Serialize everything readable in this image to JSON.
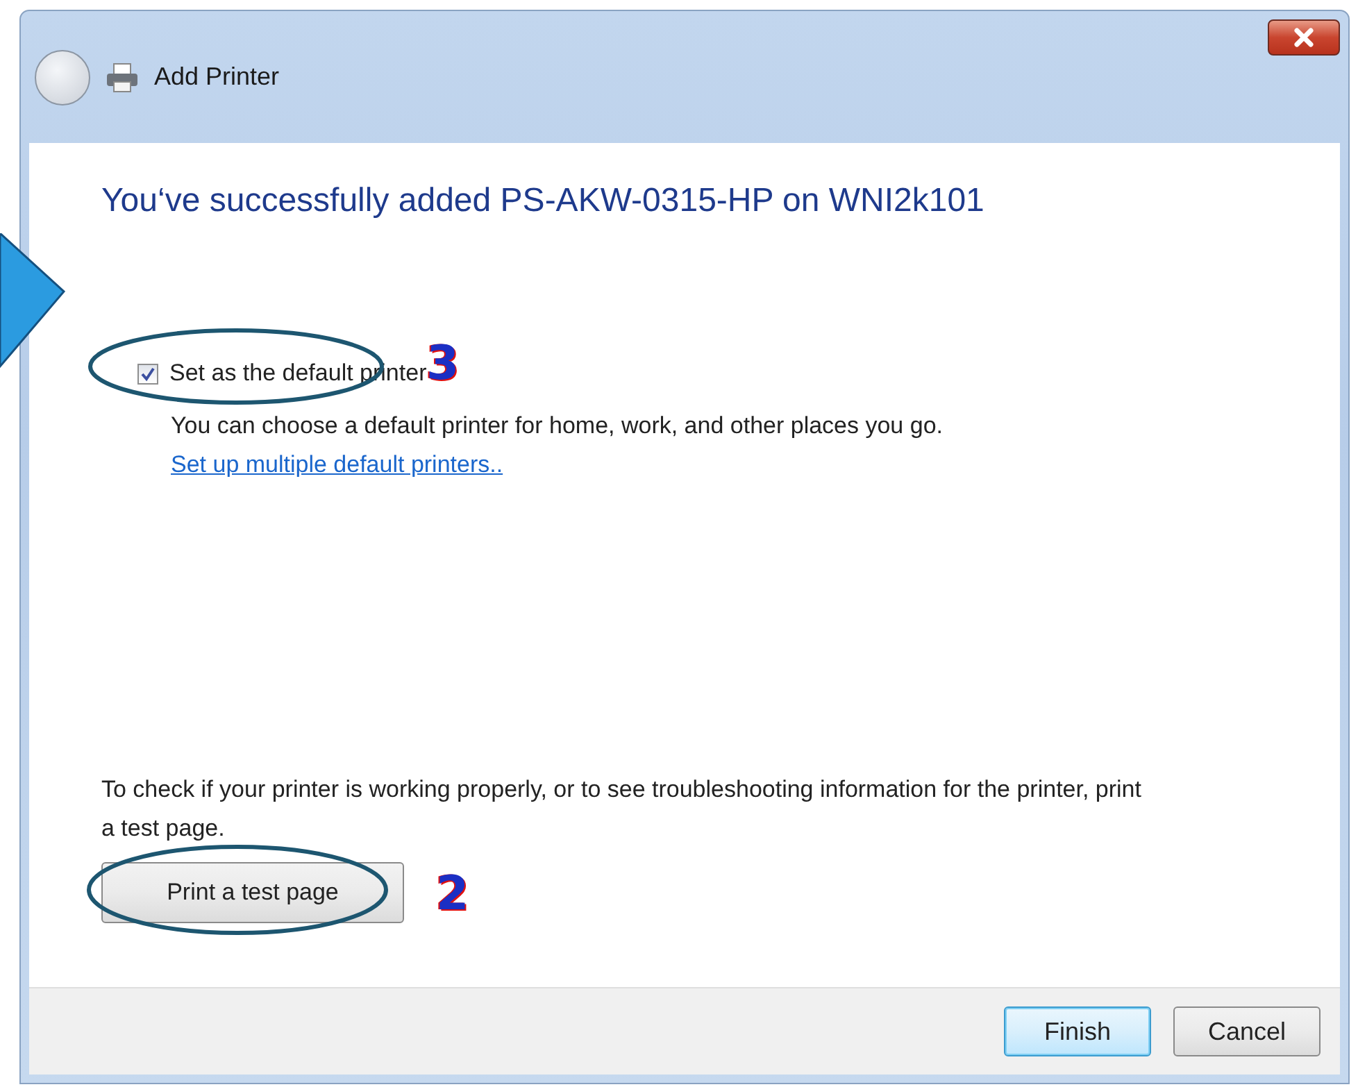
{
  "window": {
    "title": "Add Printer"
  },
  "heading": "You‘ve successfully added PS-AKW-0315-HP on WNI2k101",
  "default_checkbox": {
    "label": "Set as the default printer",
    "checked": true
  },
  "description": {
    "text": "You can choose a default printer for home, work, and other places you go.",
    "link": "Set up multiple default printers.."
  },
  "test_info": "To check if your printer is working properly, or to see troubleshooting information for the printer, print a test page.",
  "test_button": "Print a test page",
  "buttons": [
    {
      "label": "Finish",
      "default": true
    },
    {
      "label": "Cancel",
      "default": false
    }
  ],
  "annotations": [
    {
      "kind": "number",
      "text": "3"
    },
    {
      "kind": "number",
      "text": "2"
    }
  ]
}
